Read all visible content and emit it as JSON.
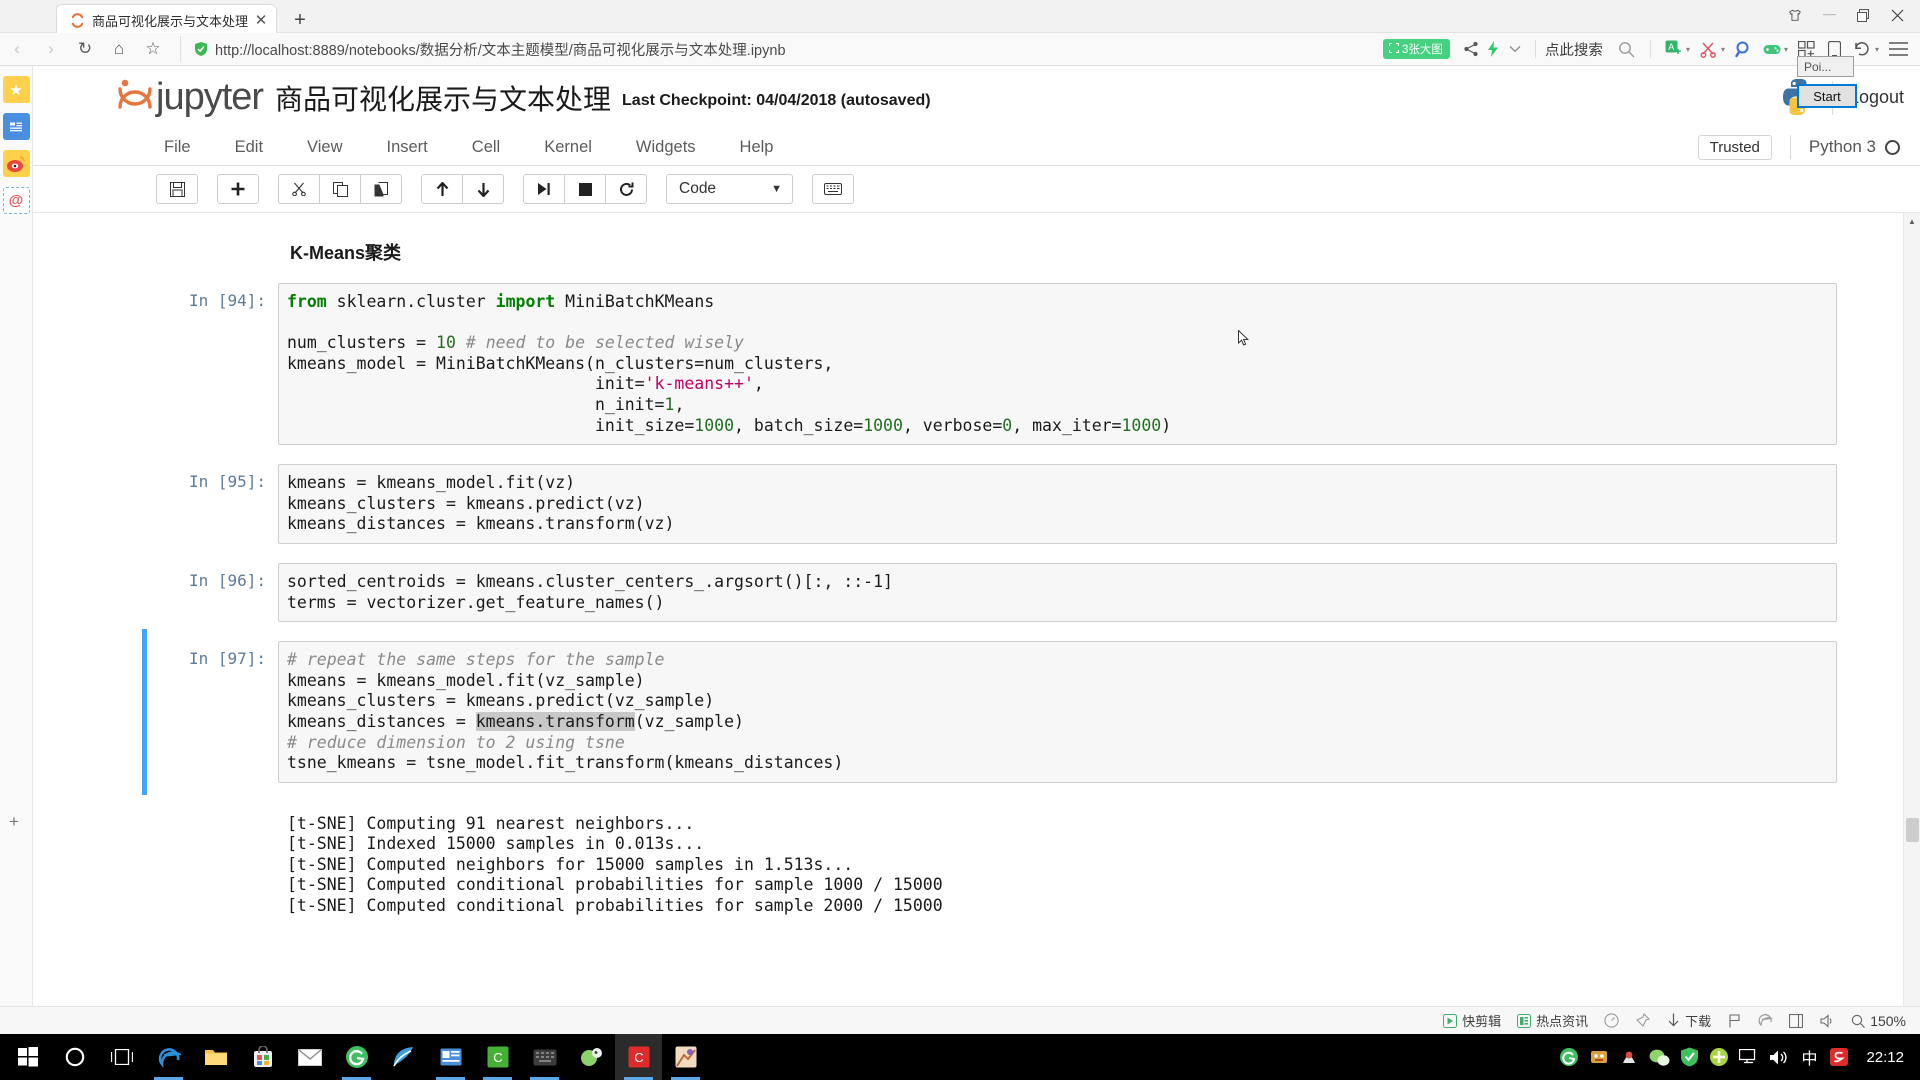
{
  "browser": {
    "tab": {
      "title": "商品可视化展示与文本处理",
      "close_label": "✕",
      "favicon": "loading-spinner-icon"
    },
    "newtab_label": "+",
    "window_controls": {
      "skin": "▽",
      "minimize": "—",
      "maximize": "❐",
      "close": "✕"
    },
    "nav": {
      "back": "‹",
      "forward": "›",
      "reload": "↻",
      "home": "⌂",
      "favorite": "☆"
    },
    "url": {
      "scheme": "http://",
      "host": "localhost",
      "rest": ":8889/notebooks/数据分析/文本主题模型/商品可视化展示与文本处理.ipynb",
      "full": "http://localhost:8889/notebooks/数据分析/文本主题模型/商品可视化展示与文本处理.ipynb"
    },
    "bigpic_badge": "3张大图",
    "search_hint": "点此搜索",
    "right_icons": [
      "search-icon",
      "translate-icon",
      "scissors-icon",
      "magnifier-icon",
      "game-icon",
      "extensions-icon",
      "mobile-icon",
      "history-icon",
      "menu-icon"
    ],
    "sidebar_icons": [
      "favorites-star-icon",
      "news-icon",
      "weibo-icon",
      "mail-at-icon"
    ],
    "sidebar_add": "+"
  },
  "popup": {
    "title": "Poi...",
    "button": "Start"
  },
  "jupyter": {
    "brand": "jupyter",
    "notebook_title": "商品可视化展示与文本处理",
    "checkpoint": "Last Checkpoint: 04/04/2018 (autosaved)",
    "logout": "Logout",
    "menus": [
      "File",
      "Edit",
      "View",
      "Insert",
      "Cell",
      "Kernel",
      "Widgets",
      "Help"
    ],
    "trusted": "Trusted",
    "kernel": "Python 3",
    "toolbar": {
      "save": "💾",
      "insert": "✚",
      "cut": "✂",
      "copy": "⧉",
      "paste": "📋",
      "move_up": "↑",
      "move_down": "↓",
      "run": "▶|",
      "stop": "■",
      "restart": "⟳",
      "cell_type": "Code",
      "cell_type_caret": "▼",
      "command_palette": "⌨"
    }
  },
  "notebook": {
    "markdown_heading": "K-Means聚类",
    "cells": [
      {
        "prompt": "In [94]:",
        "selected": false,
        "lines": [
          "from sklearn.cluster import MiniBatchKMeans",
          "",
          "num_clusters = 10 # need to be selected wisely",
          "kmeans_model = MiniBatchKMeans(n_clusters=num_clusters,",
          "                               init='k-means++',",
          "                               n_init=1,",
          "                               init_size=1000, batch_size=1000, verbose=0, max_iter=1000)"
        ]
      },
      {
        "prompt": "In [95]:",
        "selected": false,
        "lines": [
          "kmeans = kmeans_model.fit(vz)",
          "kmeans_clusters = kmeans.predict(vz)",
          "kmeans_distances = kmeans.transform(vz)"
        ]
      },
      {
        "prompt": "In [96]:",
        "selected": false,
        "lines": [
          "sorted_centroids = kmeans.cluster_centers_.argsort()[:, ::-1]",
          "terms = vectorizer.get_feature_names()"
        ]
      },
      {
        "prompt": "In [97]:",
        "selected": true,
        "lines": [
          "# repeat the same steps for the sample",
          "kmeans = kmeans_model.fit(vz_sample)",
          "kmeans_clusters = kmeans.predict(vz_sample)",
          "kmeans_distances = kmeans.transform(vz_sample)",
          "# reduce dimension to 2 using tsne",
          "tsne_kmeans = tsne_model.fit_transform(kmeans_distances)"
        ],
        "selection_text": "kmeans.transform",
        "output": [
          "[t-SNE] Computing 91 nearest neighbors...",
          "[t-SNE] Indexed 15000 samples in 0.013s...",
          "[t-SNE] Computed neighbors for 15000 samples in 1.513s...",
          "[t-SNE] Computed conditional probabilities for sample 1000 / 15000",
          "[t-SNE] Computed conditional probabilities for sample 2000 / 15000"
        ]
      }
    ]
  },
  "statusbar": {
    "items": [
      {
        "icon": "video-clip-icon",
        "label": "快剪辑"
      },
      {
        "icon": "hotnews-icon",
        "label": "热点资讯"
      },
      {
        "icon": "speed-icon",
        "label": ""
      },
      {
        "icon": "pin-icon",
        "label": ""
      },
      {
        "icon": "download-icon",
        "label": "下载"
      },
      {
        "icon": "flag-icon",
        "label": ""
      },
      {
        "icon": "edge-icon",
        "label": ""
      },
      {
        "icon": "window-icon",
        "label": ""
      },
      {
        "icon": "volume-icon",
        "label": ""
      },
      {
        "icon": "zoom-icon",
        "label": "150%"
      }
    ]
  },
  "taskbar": {
    "start": "windows-start-icon",
    "items": [
      "cortana-icon",
      "taskview-icon",
      "edge-icon",
      "explorer-icon",
      "store-icon",
      "mail-icon",
      "browser-360-icon",
      "foxmail-icon",
      "news-app-icon",
      "wps-icon",
      "editor-icon",
      "qq-icon",
      "camtasia-icon",
      "paint-icon"
    ],
    "tray": [
      "chrome-green-icon",
      "tool-a-icon",
      "tool-b-icon",
      "wechat-icon",
      "shield-icon",
      "plus-green-icon",
      "network-icon",
      "volume-icon",
      "ime-icon",
      "sogou-icon"
    ],
    "clock": "22:12"
  },
  "colors": {
    "accent_blue": "#42a5f5",
    "badge_green": "#45d17f",
    "keyword_green": "#007f00",
    "string_pink": "#bb0066",
    "comment_gray": "#8a8a8a"
  }
}
